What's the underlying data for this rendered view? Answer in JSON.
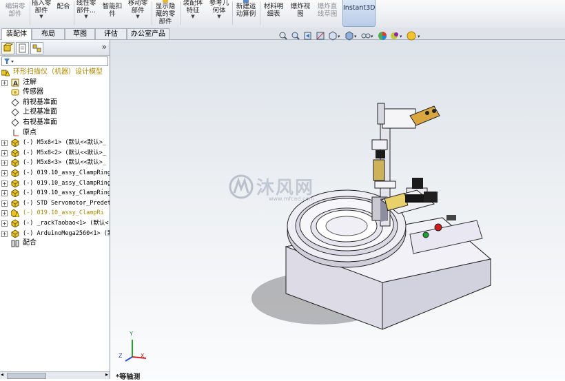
{
  "ribbon": {
    "buttons": [
      {
        "label": "编辑零\n部件",
        "disabled": true
      },
      {
        "label": "插入零\n部件",
        "dropdown": true
      },
      {
        "label": "配合"
      },
      {
        "label": "线性零\n部件...",
        "dropdown": true
      },
      {
        "label": "智能扣\n件"
      },
      {
        "label": "移动零\n部件",
        "dropdown": true
      },
      {
        "label": "显示隐\n藏的零\n部件"
      },
      {
        "label": "装配体\n特征",
        "dropdown": true
      },
      {
        "label": "参考几\n何体",
        "dropdown": true
      },
      {
        "label": "新建运\n动算例"
      },
      {
        "label": "材料明\n细表"
      },
      {
        "label": "爆炸视\n图"
      },
      {
        "label": "爆炸直\n线草图",
        "disabled": true
      },
      {
        "label": "Instant3D",
        "active": true
      }
    ]
  },
  "tabs": [
    "装配体",
    "布局",
    "草图",
    "评估",
    "办公室产品"
  ],
  "active_tab": "装配体",
  "panel": {
    "expand_glyph": "»",
    "tree": [
      {
        "text": "环形扫描仪（机器）设计模型",
        "icon": "assembly-warning-icon",
        "level": 0,
        "style": "root"
      },
      {
        "text": "注解",
        "icon": "annotation-icon",
        "level": 1,
        "expander": "+"
      },
      {
        "text": "传感器",
        "icon": "sensor-icon",
        "level": 1
      },
      {
        "text": "前视基准面",
        "icon": "plane-icon",
        "level": 1
      },
      {
        "text": "上视基准面",
        "icon": "plane-icon",
        "level": 1
      },
      {
        "text": "右视基准面",
        "icon": "plane-icon",
        "level": 1
      },
      {
        "text": "原点",
        "icon": "origin-icon",
        "level": 1
      },
      {
        "text": "(-) M5x8<1> (默认<<默认>_",
        "icon": "part-icon",
        "level": 1,
        "expander": "+",
        "mono": true
      },
      {
        "text": "(-) M5x8<2> (默认<<默认>_",
        "icon": "part-icon",
        "level": 1,
        "expander": "+",
        "mono": true
      },
      {
        "text": "(-) M5x8<3> (默认<<默认>_",
        "icon": "part-icon",
        "level": 1,
        "expander": "+",
        "mono": true
      },
      {
        "text": "(-) 019.10_assy_ClampRing.",
        "icon": "part-icon",
        "level": 1,
        "expander": "+",
        "mono": true
      },
      {
        "text": "(-) 019.10_assy_ClampRing.",
        "icon": "part-icon",
        "level": 1,
        "expander": "+",
        "mono": true
      },
      {
        "text": "(-) 019.10_assy_ClampRing.",
        "icon": "part-icon",
        "level": 1,
        "expander": "+",
        "mono": true
      },
      {
        "text": "(-) STD Servomotor_Predet.",
        "icon": "part-icon",
        "level": 1,
        "expander": "+",
        "mono": true
      },
      {
        "text": "(-) 019.10_assy_ClampRi",
        "icon": "part-warning-icon",
        "level": 1,
        "expander": "+",
        "mono": true,
        "style": "gold"
      },
      {
        "text": "(-) _rackTaobao<1> (默认<",
        "icon": "part-icon",
        "level": 1,
        "expander": "+",
        "mono": true
      },
      {
        "text": "(-) ArduinoMega2560<1> (默",
        "icon": "part-icon",
        "level": 1,
        "expander": "+",
        "mono": true
      },
      {
        "text": "配合",
        "icon": "mates-icon",
        "level": 1
      }
    ]
  },
  "viewport": {
    "view_name": "*等轴测",
    "watermark_text": "沐风网",
    "watermark_url": "www.mfcad.com",
    "triad_axes": [
      "X",
      "Y",
      "Z"
    ]
  },
  "colors": {
    "accent": "#b8cbe8",
    "gold_text": "#b08a00",
    "part_yellow": "#e8c428"
  }
}
